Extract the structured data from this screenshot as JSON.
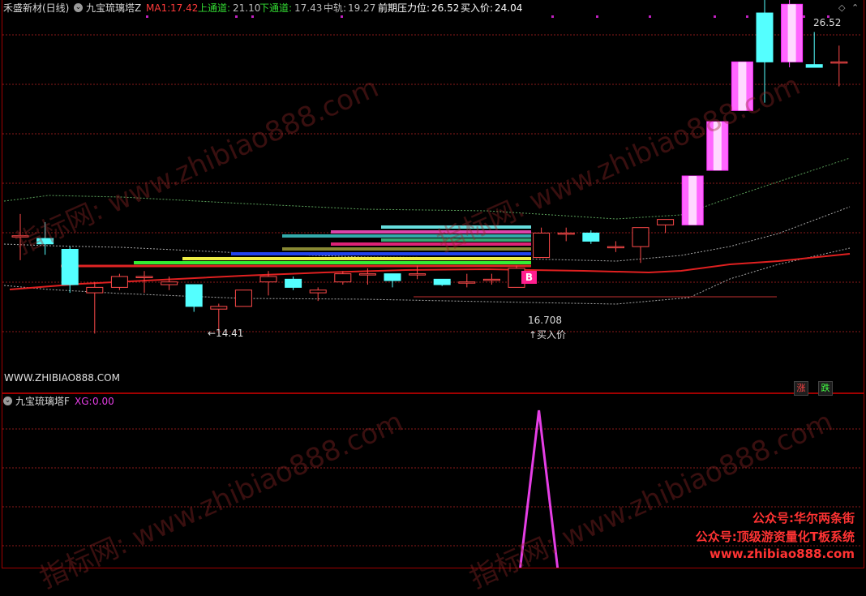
{
  "main_panel": {
    "stock_name": "禾盛新材(日线)",
    "indicator_name": "九宝琉璃塔Z",
    "ma1": {
      "label": "MA1:",
      "value": "17.42"
    },
    "upper": {
      "label": "上通道:",
      "value": "21.10"
    },
    "lower": {
      "label": "下通道:",
      "value": "17.43"
    },
    "mid": {
      "label": "中轨:",
      "value": "19.27"
    },
    "resistance": {
      "label": "前期压力位:",
      "value": "26.52"
    },
    "buy_price": {
      "label": "买入价:",
      "value": "24.04"
    },
    "website": "WWW.ZHIBIAO888.COM",
    "annotations": {
      "low_mark": "←14.41",
      "buy_value": "16.708",
      "buy_label": "↑买入价",
      "high_mark": "26.52",
      "b_signal": "B"
    },
    "badges": {
      "rise": "涨",
      "fall": "跌"
    }
  },
  "sub_panel": {
    "indicator_name": "九宝琉璃塔F",
    "xg": {
      "label": "XG:",
      "value": "0.00"
    }
  },
  "watermark": {
    "text": "指标网: www.zhibiao888.com",
    "promo_lines": [
      "公众号:华尔两条街",
      "公众号:顶级游资量化T板系统",
      "www.zhibiao888.com"
    ]
  },
  "colors": {
    "background": "#000000",
    "grid": "#8a1a1a",
    "up_candle": "#ff4a4a",
    "down_candle": "#54ffff",
    "limit_up_candle": "#ff44ff",
    "ma_line": "#e02020",
    "channel_line": "#a8a8a8",
    "xg_line": "#e53ee5"
  },
  "chart_data": {
    "type": "candlestick",
    "series": [
      {
        "name": "MA1",
        "last_value": 17.42
      },
      {
        "name": "上通道",
        "last_value": 21.1
      },
      {
        "name": "下通道",
        "last_value": 17.43
      },
      {
        "name": "中轨",
        "last_value": 19.27
      }
    ],
    "candles": [
      {
        "o": 18.0,
        "h": 18.8,
        "l": 17.1,
        "c": 18.0
      },
      {
        "o": 17.9,
        "h": 18.5,
        "l": 17.3,
        "c": 17.7
      },
      {
        "o": 17.5,
        "h": 17.6,
        "l": 15.9,
        "c": 16.2
      },
      {
        "o": 15.9,
        "h": 16.3,
        "l": 14.4,
        "c": 16.1
      },
      {
        "o": 16.1,
        "h": 16.6,
        "l": 16.0,
        "c": 16.5
      },
      {
        "o": 16.5,
        "h": 16.7,
        "l": 15.9,
        "c": 16.5
      },
      {
        "o": 16.2,
        "h": 16.5,
        "l": 16.0,
        "c": 16.3
      },
      {
        "o": 16.2,
        "h": 16.2,
        "l": 15.2,
        "c": 15.4
      },
      {
        "o": 15.3,
        "h": 15.5,
        "l": 14.41,
        "c": 15.4
      },
      {
        "o": 15.4,
        "h": 16.0,
        "l": 15.4,
        "c": 16.0
      },
      {
        "o": 16.3,
        "h": 16.7,
        "l": 15.8,
        "c": 16.5
      },
      {
        "o": 16.4,
        "h": 16.5,
        "l": 16.0,
        "c": 16.1
      },
      {
        "o": 15.9,
        "h": 16.1,
        "l": 15.6,
        "c": 16.0
      },
      {
        "o": 16.3,
        "h": 16.7,
        "l": 16.2,
        "c": 16.6
      },
      {
        "o": 16.6,
        "h": 16.8,
        "l": 16.2,
        "c": 16.6
      },
      {
        "o": 16.6,
        "h": 16.6,
        "l": 16.1,
        "c": 16.35
      },
      {
        "o": 16.6,
        "h": 16.9,
        "l": 16.4,
        "c": 16.6
      },
      {
        "o": 16.4,
        "h": 16.4,
        "l": 16.15,
        "c": 16.2
      },
      {
        "o": 16.3,
        "h": 16.6,
        "l": 16.1,
        "c": 16.3
      },
      {
        "o": 16.4,
        "h": 16.6,
        "l": 16.2,
        "c": 16.4
      },
      {
        "o": 16.1,
        "h": 16.9,
        "l": 16.1,
        "c": 16.8
      },
      {
        "o": 17.2,
        "h": 18.3,
        "l": 17.2,
        "c": 18.1
      },
      {
        "o": 18.1,
        "h": 18.3,
        "l": 17.8,
        "c": 18.1
      },
      {
        "o": 18.1,
        "h": 18.2,
        "l": 17.7,
        "c": 17.8
      },
      {
        "o": 17.6,
        "h": 17.8,
        "l": 17.4,
        "c": 17.6
      },
      {
        "o": 17.6,
        "h": 18.3,
        "l": 17.0,
        "c": 18.3
      },
      {
        "o": 18.4,
        "h": 18.6,
        "l": 18.1,
        "c": 18.6
      },
      {
        "o": 18.4,
        "h": 20.2,
        "l": 18.4,
        "c": 20.2
      },
      {
        "o": 22.2,
        "h": 22.2,
        "l": 22.2,
        "c": 22.2
      },
      {
        "o": 24.4,
        "h": 24.4,
        "l": 24.1,
        "c": 24.4
      },
      {
        "o": 26.2,
        "h": 26.9,
        "l": 22.9,
        "c": 24.4
      },
      {
        "o": 24.4,
        "h": 26.9,
        "l": 24.2,
        "c": 26.52
      },
      {
        "o": 24.3,
        "h": 25.5,
        "l": 24.2,
        "c": 24.2
      },
      {
        "o": 24.4,
        "h": 25.0,
        "l": 23.5,
        "c": 24.4
      }
    ],
    "limit_up_indices": [
      27,
      28,
      29,
      31
    ],
    "buy_signal_index": 20,
    "buy_value": 16.708,
    "low_value": 14.41,
    "high_value": 26.52,
    "xg": {
      "value": 0.0,
      "spike_index": 21
    }
  }
}
